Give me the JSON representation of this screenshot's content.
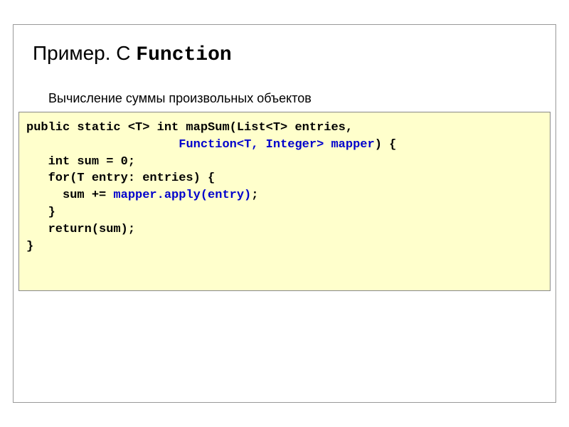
{
  "title": {
    "prefix": "Пример. С ",
    "mono": "Function"
  },
  "subtitle": "Вычисление суммы произвольных объектов",
  "code": {
    "line1a": "public static <T> int mapSum(List<T> entries,",
    "line2a": "                     ",
    "line2b": "Function<T, Integer> mapper",
    "line2c": ") {",
    "line3": "   int sum = 0;",
    "line4": "   for(T entry: entries) {",
    "line5a": "     sum += ",
    "line5b": "mapper.apply(entry)",
    "line5c": ";",
    "line6": "   }",
    "line7": "   return(sum);",
    "line8": "}"
  }
}
